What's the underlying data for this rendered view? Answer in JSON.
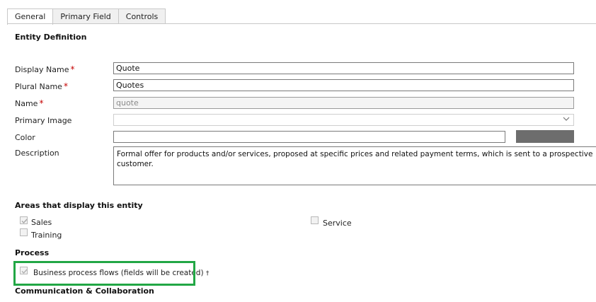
{
  "tabs": [
    {
      "label": "General"
    },
    {
      "label": "Primary Field"
    },
    {
      "label": "Controls"
    }
  ],
  "entity_definition": {
    "title": "Entity Definition",
    "display_name": {
      "label": "Display Name",
      "required": "*",
      "value": "Quote"
    },
    "plural_name": {
      "label": "Plural Name",
      "required": "*",
      "value": "Quotes"
    },
    "name": {
      "label": "Name",
      "required": "*",
      "value": "quote"
    },
    "primary_image": {
      "label": "Primary Image",
      "value": ""
    },
    "color": {
      "label": "Color",
      "value": "",
      "swatch": "#6d6d6d"
    },
    "description": {
      "label": "Description",
      "value": "Formal offer for products and/or services, proposed at specific prices and related payment terms, which is sent to a prospective customer."
    }
  },
  "areas": {
    "title": "Areas that display this entity",
    "sales": {
      "label": "Sales",
      "checked": true
    },
    "service": {
      "label": "Service",
      "checked": false
    },
    "training": {
      "label": "Training",
      "checked": false
    }
  },
  "process": {
    "title": "Process",
    "bpf": {
      "label": "Business process flows (fields will be created)",
      "marker": "†",
      "checked": true
    },
    "highlight_color": "#22a745"
  },
  "communication": {
    "title": "Communication & Collaboration"
  }
}
